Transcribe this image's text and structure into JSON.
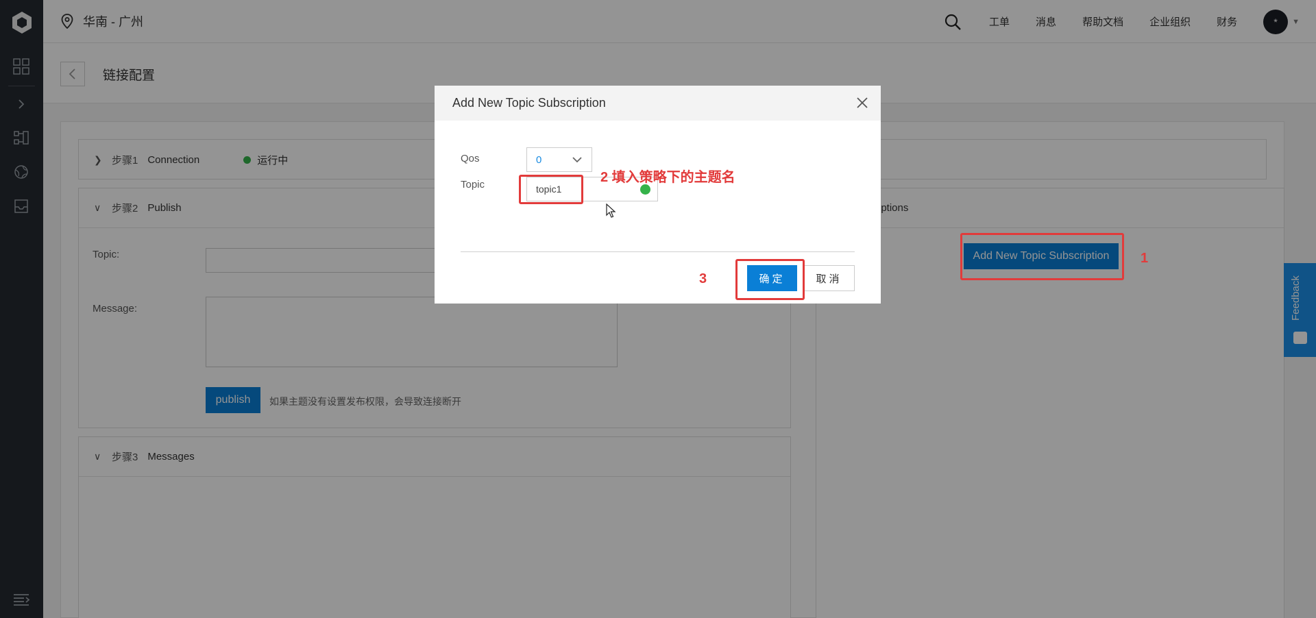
{
  "header": {
    "region": "华南 - 广州",
    "nav": [
      "工单",
      "消息",
      "帮助文档",
      "企业组织",
      "财务"
    ],
    "avatar_text": "*"
  },
  "page": {
    "title": "链接配置"
  },
  "steps": {
    "step1": {
      "step": "步骤1",
      "name": "Connection",
      "status": "运行中"
    },
    "step2": {
      "step": "步骤2",
      "name": "Publish"
    },
    "step3": {
      "step": "步骤3",
      "name": "Messages"
    }
  },
  "publish": {
    "topic_label": "Topic:",
    "message_label": "Message:",
    "button": "publish",
    "note": "如果主题没有设置发布权限，会导致连接断开"
  },
  "subscriptions": {
    "title_fragment": "riptions",
    "add_button": "Add New Topic Subscription"
  },
  "feedback": {
    "label": "Feedback"
  },
  "modal": {
    "title": "Add New Topic Subscription",
    "qos_label": "Qos",
    "qos_value": "0",
    "topic_label": "Topic",
    "topic_value": "topic1",
    "ok": "确定",
    "cancel": "取消"
  },
  "annotations": {
    "one": "1",
    "two": "2 填入策略下的主题名",
    "three": "3"
  },
  "colors": {
    "primary": "#0a7fd6",
    "status_green": "#35b34a",
    "annotation_red": "#e23b3b",
    "rail": "#252a31"
  }
}
